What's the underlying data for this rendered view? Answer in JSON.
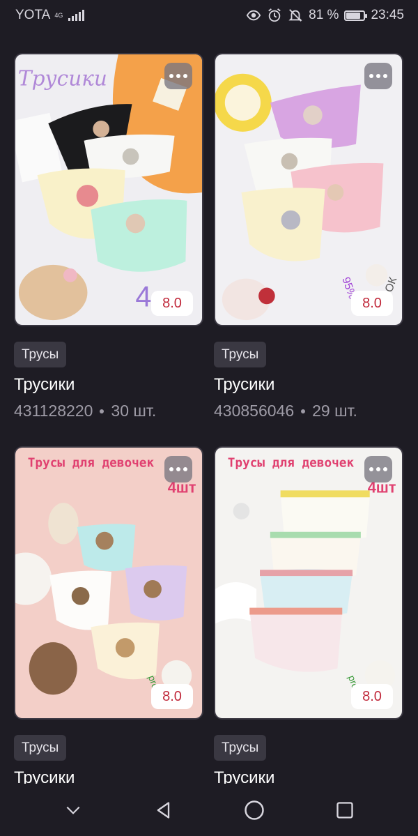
{
  "status_bar": {
    "carrier": "YOTA",
    "network": "4G",
    "battery": "81 %",
    "battery_level": 0.81,
    "time": "23:45",
    "icons": [
      "eye-icon",
      "alarm-icon",
      "mute-bell-icon",
      "battery-icon"
    ]
  },
  "cards": [
    {
      "image_text": "Трусики",
      "image_number": "4",
      "rating": "8.0",
      "tag": "Трусы",
      "title": "Трусики",
      "article": "431128220",
      "count": "30 шт."
    },
    {
      "image_text": "95%",
      "image_text2": "ПОК",
      "rating": "8.0",
      "tag": "Трусы",
      "title": "Трусики",
      "article": "430856046",
      "count": "29 шт."
    },
    {
      "image_text": "Трусы для девочек",
      "image_badge": "4шт",
      "image_text2": "pre",
      "rating": "8.0",
      "tag": "Трусы",
      "title": "Трусики"
    },
    {
      "image_text": "Трусы для девочек",
      "image_badge": "4шт",
      "image_text2": "pre",
      "rating": "8.0",
      "tag": "Трусы",
      "title": "Трусики"
    }
  ],
  "nav": [
    "chevron-down-icon",
    "back-icon",
    "home-icon",
    "recents-icon"
  ],
  "colors": {
    "background": "#1e1c24",
    "tag_bg": "#3a3842",
    "rating_text": "#c0283a"
  }
}
